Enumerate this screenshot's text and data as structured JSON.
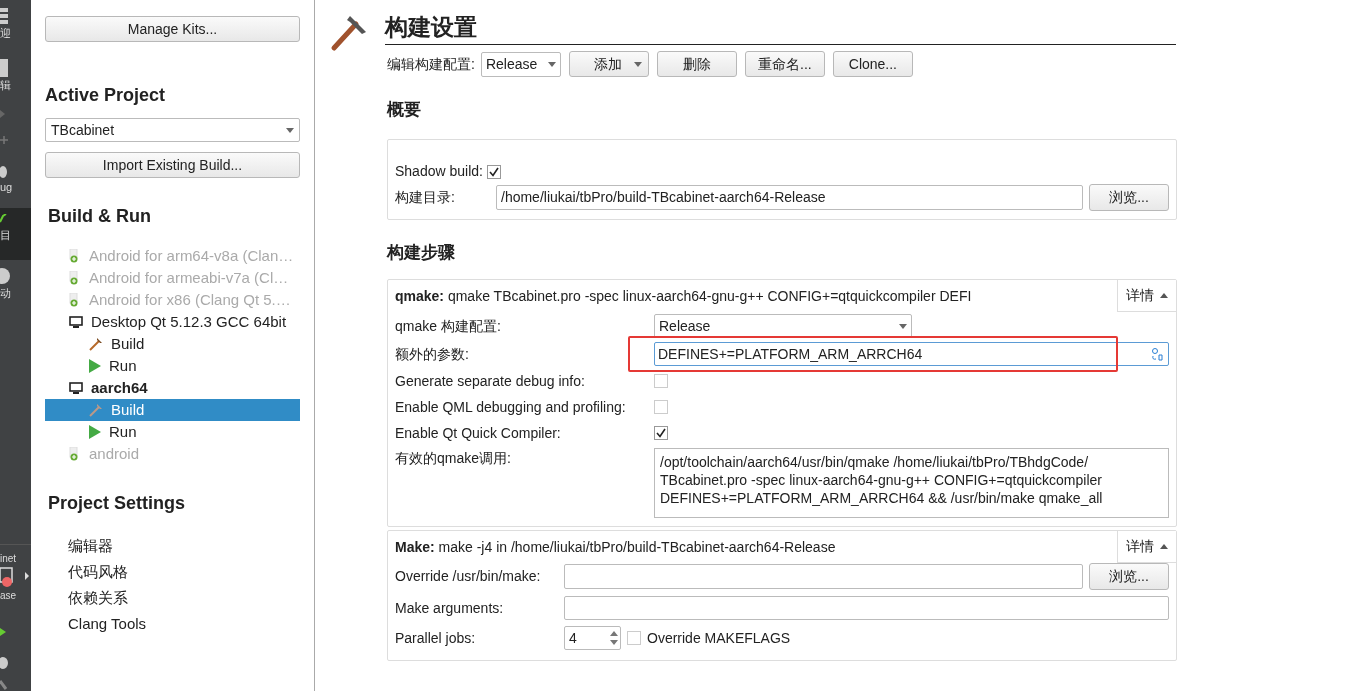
{
  "mode_bar": {
    "items": [
      {
        "kind": "grid",
        "label": "迎",
        "selected": false
      },
      {
        "kind": "doc",
        "label": "辑",
        "selected": false
      },
      {
        "kind": "design",
        "selected": false
      },
      {
        "kind": "bug",
        "label": "ug",
        "selected": false
      },
      {
        "kind": "wrench",
        "label": "目",
        "selected": true
      },
      {
        "kind": "help",
        "label": "动",
        "selected": false
      }
    ],
    "target": {
      "project": "inet",
      "config": "ase"
    }
  },
  "sidebar": {
    "manage_kits": "Manage Kits...",
    "active_project_heading": "Active Project",
    "project_select": "TBcabinet",
    "import_button": "Import Existing Build...",
    "build_run_heading": "Build & Run",
    "tree": [
      {
        "kind": "android",
        "label": "Android for arm64-v8a (Clan…",
        "disabled": true,
        "bold": false,
        "selected": false
      },
      {
        "kind": "android",
        "label": "Android for armeabi-v7a (Cl…",
        "disabled": true,
        "bold": false,
        "selected": false
      },
      {
        "kind": "android",
        "label": "Android for x86 (Clang Qt 5.…",
        "disabled": true,
        "bold": false,
        "selected": false
      },
      {
        "kind": "desktop",
        "label": "Desktop Qt 5.12.3 GCC 64bit",
        "disabled": false,
        "bold": false,
        "selected": false,
        "children": [
          {
            "kind": "build",
            "label": "Build",
            "selected": false
          },
          {
            "kind": "run",
            "label": "Run",
            "selected": false
          }
        ]
      },
      {
        "kind": "desktop",
        "label": "aarch64",
        "disabled": false,
        "bold": true,
        "selected": false,
        "children": [
          {
            "kind": "build",
            "label": "Build",
            "selected": true
          },
          {
            "kind": "run",
            "label": "Run",
            "selected": false
          }
        ]
      },
      {
        "kind": "android",
        "label": "android",
        "disabled": true,
        "bold": false,
        "selected": false
      }
    ],
    "project_settings_heading": "Project Settings",
    "settings_items": [
      "编辑器",
      "代码风格",
      "依赖关系",
      "Clang Tools"
    ]
  },
  "main": {
    "title": "构建设置",
    "config_label": "编辑构建配置:",
    "config_select": "Release",
    "buttons": [
      {
        "kind": "menu",
        "label": "添加"
      },
      {
        "kind": "plain",
        "label": "删除"
      },
      {
        "kind": "plain",
        "label": "重命名..."
      },
      {
        "kind": "plain",
        "label": "Clone..."
      }
    ],
    "overview": {
      "heading": "概要",
      "shadow_label": "Shadow build:",
      "shadow_checked": true,
      "dir_label": "构建目录:",
      "dir_value": "/home/liukai/tbPro/build-TBcabinet-aarch64-Release",
      "browse": "浏览..."
    },
    "steps_heading": "构建步骤",
    "qmake": {
      "summary_bold": "qmake:",
      "summary": "qmake TBcabinet.pro -spec linux-aarch64-gnu-g++ CONFIG+=qtquickcompiler DEFI",
      "details": "详情",
      "expanded": true,
      "rows": [
        {
          "kind": "select",
          "label": "qmake 构建配置:",
          "value": "Release"
        },
        {
          "kind": "input",
          "label": "额外的参数:",
          "value": "DEFINES+=PLATFORM_ARM_ARRCH64",
          "highlighted": true
        },
        {
          "kind": "check",
          "label": "Generate separate debug info:",
          "checked": false
        },
        {
          "kind": "check",
          "label": "Enable QML debugging and profiling:",
          "checked": false
        },
        {
          "kind": "check",
          "label": "Enable Qt Quick Compiler:",
          "checked": true
        },
        {
          "kind": "text",
          "label": "有效的qmake调用:",
          "value": "/opt/toolchain/aarch64/usr/bin/qmake /home/liukai/tbPro/TBhdgCode/ TBcabinet.pro -spec linux-aarch64-gnu-g++ CONFIG+=qtquickcompiler DEFINES+=PLATFORM_ARM_ARRCH64 && /usr/bin/make qmake_all"
        }
      ]
    },
    "make": {
      "summary_bold": "Make:",
      "summary": "make -j4 in /home/liukai/tbPro/build-TBcabinet-aarch64-Release",
      "details": "详情",
      "expanded": true,
      "override_label": "Override /usr/bin/make:",
      "browse": "浏览...",
      "args_label": "Make arguments:",
      "jobs_label": "Parallel jobs:",
      "jobs_value": "4",
      "makeflags_label": "Override MAKEFLAGS",
      "makeflags_checked": false
    }
  }
}
